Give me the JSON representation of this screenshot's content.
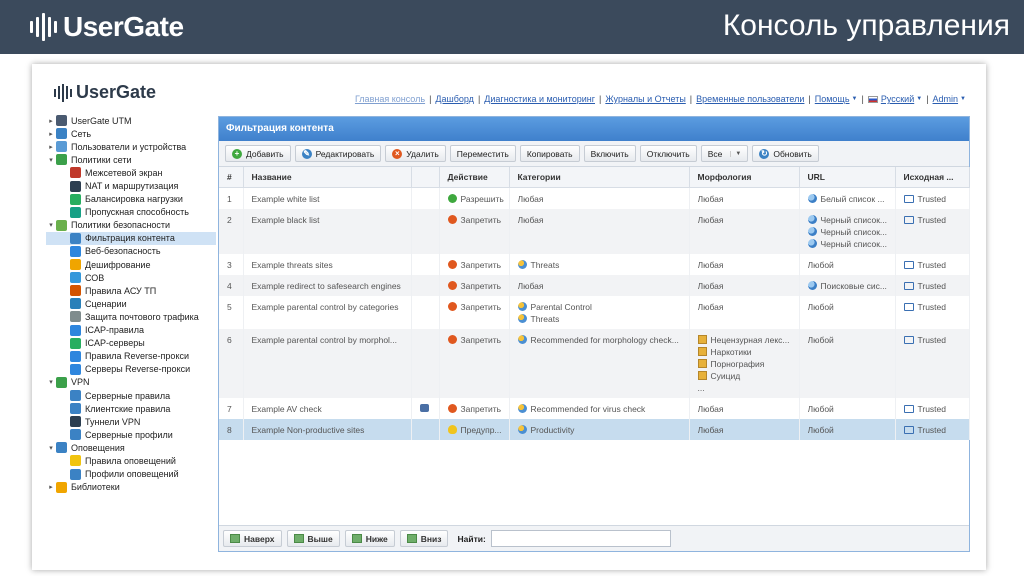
{
  "banner": {
    "logo": "UserGate",
    "title": "Консоль управления"
  },
  "app": {
    "logo": "UserGate"
  },
  "topnav": [
    {
      "label": "Главная консоль",
      "dim": true
    },
    {
      "label": "Дашборд"
    },
    {
      "label": "Диагностика и мониторинг"
    },
    {
      "label": "Журналы и Отчеты"
    },
    {
      "label": "Временные пользователи"
    },
    {
      "label": "Помощь",
      "caret": true
    },
    {
      "label": "Русский",
      "caret": true,
      "flag": true
    },
    {
      "label": "Admin",
      "caret": true
    }
  ],
  "tree": [
    {
      "label": "UserGate UTM",
      "level": 1,
      "arrow": "▸",
      "icon": "gear-icon",
      "color": "#4a5a70"
    },
    {
      "label": "Сеть",
      "level": 1,
      "arrow": "▸",
      "icon": "network-icon",
      "color": "#3b82c4"
    },
    {
      "label": "Пользователи и устройства",
      "level": 1,
      "arrow": "▸",
      "icon": "users-icon",
      "color": "#5a9bd5"
    },
    {
      "label": "Политики сети",
      "level": 1,
      "arrow": "▾",
      "icon": "policy-icon",
      "color": "#3ba04a"
    },
    {
      "label": "Межсетевой экран",
      "level": 2,
      "icon": "firewall-icon",
      "color": "#c0392b"
    },
    {
      "label": "NAT и маршрутизация",
      "level": 2,
      "icon": "nat-icon",
      "color": "#2c3e50"
    },
    {
      "label": "Балансировка нагрузки",
      "level": 2,
      "icon": "balance-icon",
      "color": "#27ae60"
    },
    {
      "label": "Пропускная способность",
      "level": 2,
      "icon": "bandwidth-icon",
      "color": "#16a085"
    },
    {
      "label": "Политики безопасности",
      "level": 1,
      "arrow": "▾",
      "icon": "shield-icon",
      "color": "#6ab04c"
    },
    {
      "label": "Фильтрация контента",
      "level": 2,
      "icon": "filter-icon",
      "color": "#3b82c4",
      "selected": true
    },
    {
      "label": "Веб-безопасность",
      "level": 2,
      "icon": "web-icon",
      "color": "#2e86de"
    },
    {
      "label": "Дешифрование",
      "level": 2,
      "icon": "decrypt-icon",
      "color": "#f0a500"
    },
    {
      "label": "СОВ",
      "level": 2,
      "icon": "ids-icon",
      "color": "#3498db"
    },
    {
      "label": "Правила АСУ ТП",
      "level": 2,
      "icon": "scada-icon",
      "color": "#d35400"
    },
    {
      "label": "Сценарии",
      "level": 2,
      "icon": "scenario-icon",
      "color": "#2980b9"
    },
    {
      "label": "Защита почтового трафика",
      "level": 2,
      "icon": "mail-icon",
      "color": "#7f8c8d"
    },
    {
      "label": "ICAP-правила",
      "level": 2,
      "icon": "icap-icon",
      "color": "#2e86de"
    },
    {
      "label": "ICAP-серверы",
      "level": 2,
      "icon": "icap-server-icon",
      "color": "#27ae60"
    },
    {
      "label": "Правила Reverse-прокси",
      "level": 2,
      "icon": "reverse-proxy-icon",
      "color": "#2e86de"
    },
    {
      "label": "Серверы Reverse-прокси",
      "level": 2,
      "icon": "reverse-server-icon",
      "color": "#2e86de"
    },
    {
      "label": "VPN",
      "level": 1,
      "arrow": "▾",
      "icon": "vpn-icon",
      "color": "#3ba04a"
    },
    {
      "label": "Серверные правила",
      "level": 2,
      "icon": "server-rules-icon",
      "color": "#3b82c4"
    },
    {
      "label": "Клиентские правила",
      "level": 2,
      "icon": "client-rules-icon",
      "color": "#3b82c4"
    },
    {
      "label": "Туннели VPN",
      "level": 2,
      "icon": "tunnel-icon",
      "color": "#2c3e50"
    },
    {
      "label": "Серверные профили",
      "level": 2,
      "icon": "server-profile-icon",
      "color": "#3b82c4"
    },
    {
      "label": "Оповещения",
      "level": 1,
      "arrow": "▾",
      "icon": "alert-icon",
      "color": "#3b82c4"
    },
    {
      "label": "Правила оповещений",
      "level": 2,
      "icon": "alert-rules-icon",
      "color": "#f1c40f"
    },
    {
      "label": "Профили оповещений",
      "level": 2,
      "icon": "alert-profile-icon",
      "color": "#3b82c4"
    },
    {
      "label": "Библиотеки",
      "level": 1,
      "arrow": "▸",
      "icon": "library-icon",
      "color": "#f0a500"
    }
  ],
  "panel": {
    "title": "Фильтрация контента",
    "toolbar": [
      {
        "label": "Добавить",
        "icon": "add-icon",
        "color": "#3ea83e",
        "glyph": "+"
      },
      {
        "label": "Редактировать",
        "icon": "edit-icon",
        "color": "#3b82c4",
        "glyph": "✎"
      },
      {
        "label": "Удалить",
        "icon": "delete-icon",
        "color": "#e0581f",
        "glyph": "×"
      },
      {
        "label": "Переместить"
      },
      {
        "label": "Копировать"
      },
      {
        "label": "Включить"
      },
      {
        "label": "Отключить"
      },
      {
        "label": "Все",
        "caret": true
      },
      {
        "label": "Обновить",
        "icon": "refresh-icon",
        "color": "#3b82c4",
        "glyph": "↻"
      }
    ],
    "columns": [
      "#",
      "Название",
      "",
      "Действие",
      "Категории",
      "Морфология",
      "URL",
      "Исходная ..."
    ],
    "rows": [
      {
        "num": "1",
        "name": "Example white list",
        "action": "Разрешить",
        "actionType": "allow",
        "categories": [
          "Любая"
        ],
        "catIcon": false,
        "morphology": [
          "Любая"
        ],
        "morphIcon": false,
        "url": [
          "Белый список ..."
        ],
        "urlIcon": true,
        "source": "Trusted"
      },
      {
        "num": "2",
        "name": "Example black list",
        "action": "Запретить",
        "actionType": "deny",
        "categories": [
          "Любая"
        ],
        "catIcon": false,
        "morphology": [
          "Любая"
        ],
        "morphIcon": false,
        "url": [
          "Черный список...",
          "Черный список...",
          "Черный список..."
        ],
        "urlIcon": true,
        "source": "Trusted"
      },
      {
        "num": "3",
        "name": "Example threats sites",
        "action": "Запретить",
        "actionType": "deny",
        "categories": [
          "Threats"
        ],
        "catIcon": true,
        "morphology": [
          "Любая"
        ],
        "morphIcon": false,
        "url": [
          "Любой"
        ],
        "urlIcon": false,
        "source": "Trusted"
      },
      {
        "num": "4",
        "name": "Example redirect to safesearch engines",
        "action": "Запретить",
        "actionType": "deny",
        "categories": [
          "Любая"
        ],
        "catIcon": false,
        "morphology": [
          "Любая"
        ],
        "morphIcon": false,
        "url": [
          "Поисковые сис..."
        ],
        "urlIcon": true,
        "source": "Trusted"
      },
      {
        "num": "5",
        "name": "Example parental control by categories",
        "action": "Запретить",
        "actionType": "deny",
        "categories": [
          "Parental Control",
          "Threats"
        ],
        "catIcon": true,
        "morphology": [
          "Любая"
        ],
        "morphIcon": false,
        "url": [
          "Любой"
        ],
        "urlIcon": false,
        "source": "Trusted"
      },
      {
        "num": "6",
        "name": "Example parental control by morphol...",
        "action": "Запретить",
        "actionType": "deny",
        "categories": [
          "Recommended for morphology check..."
        ],
        "catIcon": true,
        "morphology": [
          "Нецензурная лекс...",
          "Наркотики",
          "Порнография",
          "Суицид",
          "..."
        ],
        "morphIcon": true,
        "url": [
          "Любой"
        ],
        "urlIcon": false,
        "source": "Trusted"
      },
      {
        "num": "7",
        "name": "Example AV check",
        "av": true,
        "action": "Запретить",
        "actionType": "deny",
        "categories": [
          "Recommended for virus check"
        ],
        "catIcon": true,
        "morphology": [
          "Любая"
        ],
        "morphIcon": false,
        "url": [
          "Любой"
        ],
        "urlIcon": false,
        "source": "Trusted"
      },
      {
        "num": "8",
        "name": "Example Non-productive sites",
        "action": "Предупр...",
        "actionType": "warn",
        "categories": [
          "Productivity"
        ],
        "catIcon": true,
        "morphology": [
          "Любая"
        ],
        "morphIcon": false,
        "url": [
          "Любой"
        ],
        "urlIcon": false,
        "source": "Trusted",
        "selected": true
      }
    ],
    "bottom": {
      "buttons": [
        "Наверх",
        "Выше",
        "Ниже",
        "Вниз"
      ],
      "search_label": "Найти:",
      "search_value": ""
    }
  }
}
